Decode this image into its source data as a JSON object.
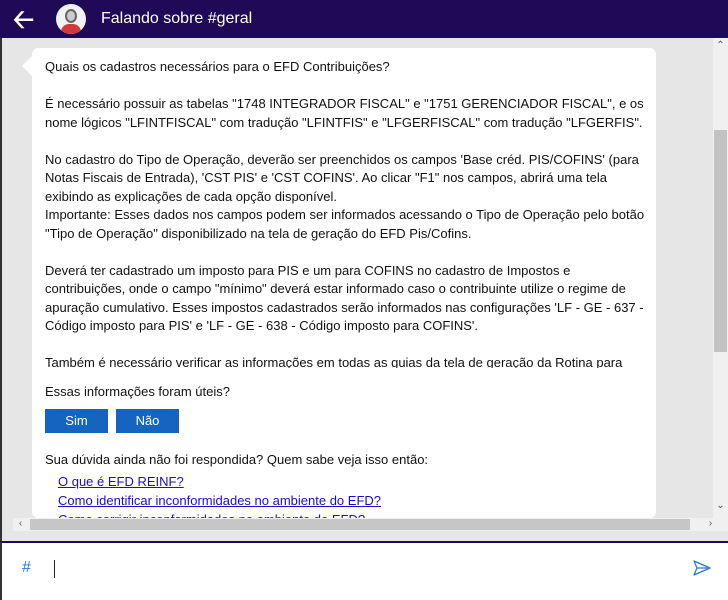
{
  "header": {
    "title": "Falando sobre #geral",
    "back_icon": "arrow-left-icon",
    "avatar_icon": "user-avatar-icon"
  },
  "message": {
    "question": "Quais os cadastros necessários para o EFD Contribuições?",
    "paragraphs": [
      "É necessário possuir as tabelas \"1748 INTEGRADOR FISCAL\" e \"1751 GERENCIADOR FISCAL\",  e os nome lógicos \"LFINTFISCAL\" com tradução \"LFINTFIS\" e \"LFGERFISCAL\" com tradução \"LFGERFIS\".",
      "No cadastro do Tipo de Operação, deverão ser preenchidos os campos 'Base créd. PIS/COFINS' (para Notas Fiscais de Entrada), 'CST PIS' e 'CST COFINS'. Ao clicar \"F1\" nos campos, abrirá uma tela exibindo as explicações de cada opção disponível.",
      "Importante: Esses dados nos campos podem ser informados acessando o Tipo de Operação pelo botão \"Tipo de Operação\" disponibilizado na tela de geração do EFD Pis/Cofins.",
      "Deverá ter cadastrado um imposto para PIS e um para COFINS no cadastro de Impostos e contribuições, onde o campo \"mínimo\" deverá estar informado caso o contribuinte utilize o regime de apuração cumulativo.  Esses impostos cadastrados serão informados nas configurações 'LF - GE - 637 - Código imposto para PIS' e 'LF - GE - 638 - Código imposto para COFINS'.",
      "Também é necessário verificar as informações em todas as guias da tela de geração da Rotina para garantir que todas as informações estão conforme o enquadramento da empresa."
    ],
    "feedback_question": "Essas informações foram úteis?",
    "yes_label": "Sim",
    "no_label": "Não",
    "related_prompt": "Sua dúvida ainda não foi respondida? Quem sabe veja isso então:",
    "related_links": [
      "O que é EFD REINF?",
      "Como identificar inconformidades no ambiente do EFD?",
      "Como corrigir inconformidades no ambiente do EFD?"
    ]
  },
  "input": {
    "prefix": "#",
    "value": "",
    "send_icon": "send-icon"
  },
  "colors": {
    "header": "#1f0a58",
    "button": "#1565c0",
    "link": "#1a0dcc"
  }
}
